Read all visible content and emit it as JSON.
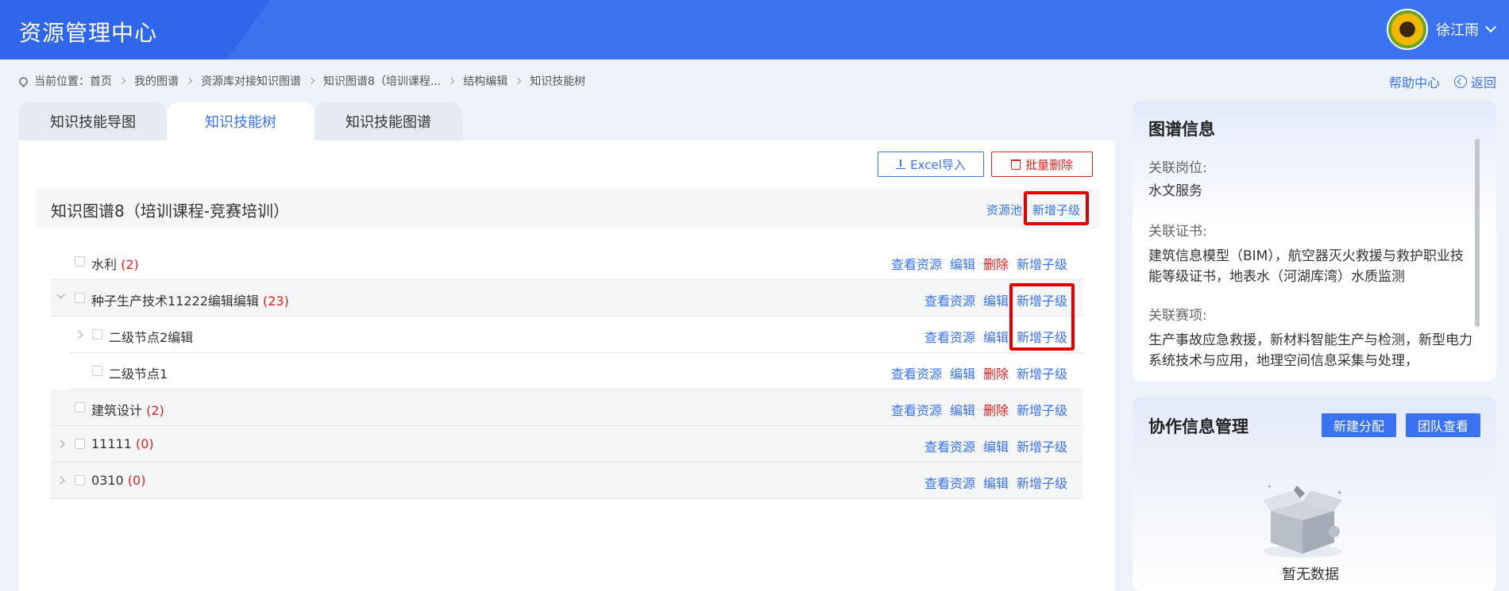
{
  "header": {
    "title": "资源管理中心",
    "user": "徐江雨"
  },
  "breadcrumb": {
    "prefix": "当前位置：",
    "items": [
      "首页",
      "我的图谱",
      "资源库对接知识图谱",
      "知识图谱8（培训课程...",
      "结构编辑",
      "知识技能树"
    ]
  },
  "toplinks": {
    "help": "帮助中心",
    "back": "返回"
  },
  "tabs": [
    {
      "label": "知识技能导图"
    },
    {
      "label": "知识技能树",
      "active": true
    },
    {
      "label": "知识技能图谱"
    }
  ],
  "toolbar": {
    "excel": "Excel导入",
    "batch_delete": "批量删除"
  },
  "root": {
    "title": "知识图谱8（培训课程-竞赛培训）",
    "pool": "资源池",
    "add": "新增子级"
  },
  "tree": [
    {
      "name": "水利",
      "count": "(2)",
      "actions": [
        "查看资源",
        "编辑",
        "删除",
        "新增子级"
      ]
    },
    {
      "name": "种子生产技术11222编辑编辑",
      "count": "(23)",
      "actions": [
        "查看资源",
        "编辑",
        "新增子级"
      ]
    },
    {
      "name": "二级节点2编辑",
      "count": "",
      "actions": [
        "查看资源",
        "编辑",
        "新增子级"
      ]
    },
    {
      "name": "二级节点1",
      "count": "",
      "actions": [
        "查看资源",
        "编辑",
        "删除",
        "新增子级"
      ]
    },
    {
      "name": "建筑设计",
      "count": "(2)",
      "actions": [
        "查看资源",
        "编辑",
        "删除",
        "新增子级"
      ]
    },
    {
      "name": "11111",
      "count": "(0)",
      "actions": [
        "查看资源",
        "编辑",
        "新增子级"
      ]
    },
    {
      "name": "0310",
      "count": "(0)",
      "actions": [
        "查看资源",
        "编辑",
        "新增子级"
      ]
    }
  ],
  "info": {
    "title": "图谱信息",
    "post_label": "关联岗位:",
    "post_value": "水文服务",
    "cert_label": "关联证书:",
    "cert_value": "建筑信息模型（BIM），航空器灭火救援与救护职业技能等级证书，地表水（河湖库湾）水质监测",
    "comp_label": "关联赛项:",
    "comp_value": "生产事故应急救援，新材料智能生产与检测，新型电力系统技术与应用，地理空间信息采集与处理，"
  },
  "collab": {
    "title": "协作信息管理",
    "new_assign": "新建分配",
    "team_view": "团队查看",
    "empty": "暂无数据"
  },
  "colors": {
    "primary": "#3a72f0",
    "danger": "#e02020",
    "highlight": "#e20000"
  }
}
